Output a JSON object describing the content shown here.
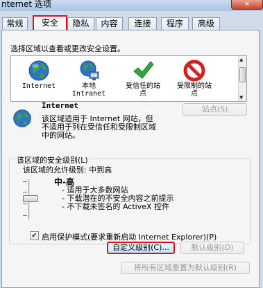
{
  "window": {
    "title": "nternet 选项",
    "close_glyph": "✕"
  },
  "tabs": [
    {
      "label": "常规"
    },
    {
      "label": "安全",
      "active": true
    },
    {
      "label": "隐私"
    },
    {
      "label": "内容"
    },
    {
      "label": "连接"
    },
    {
      "label": "程序"
    },
    {
      "label": "高级"
    }
  ],
  "security": {
    "instruction": "选择区域以查看或更改安全设置。",
    "zones": [
      {
        "label_lines": [
          "Internet"
        ],
        "icon": "globe-icon"
      },
      {
        "label_lines": [
          "本地",
          "Intranet"
        ],
        "icon": "intranet-globe-icon"
      },
      {
        "label_lines": [
          "受信任的站",
          "点"
        ],
        "icon": "checkmark-icon"
      },
      {
        "label_lines": [
          "受限制的站",
          "点"
        ],
        "icon": "prohibited-icon"
      }
    ],
    "selected_zone": {
      "name": "Internet",
      "description_lines": [
        "该区域适用于 Internet 网站，但",
        "不适用于列在受信任和受限制区域",
        "中的网站。"
      ],
      "sites_button": "站点(S)"
    },
    "level_group": {
      "legend": "该区域的安全级别(L)",
      "allowed_levels": "该区域的允许级别: 中到高",
      "current_level": "中-高",
      "bullets": [
        "- 适用于大多数网站",
        "- 下载潜在的不安全内容之前提示",
        "- 不下载未签名的 ActiveX 控件"
      ]
    },
    "protected_mode": {
      "label": "启用保护模式(要求重新启动 Internet Explorer)(P)",
      "checked": true
    },
    "custom_level_button": "自定义级别(C)...",
    "default_level_button": "默认级别(D)",
    "reset_all_button": "将所有区域重置为默认级别(R)"
  },
  "colors": {
    "accent_highlight": "#d8141a"
  }
}
